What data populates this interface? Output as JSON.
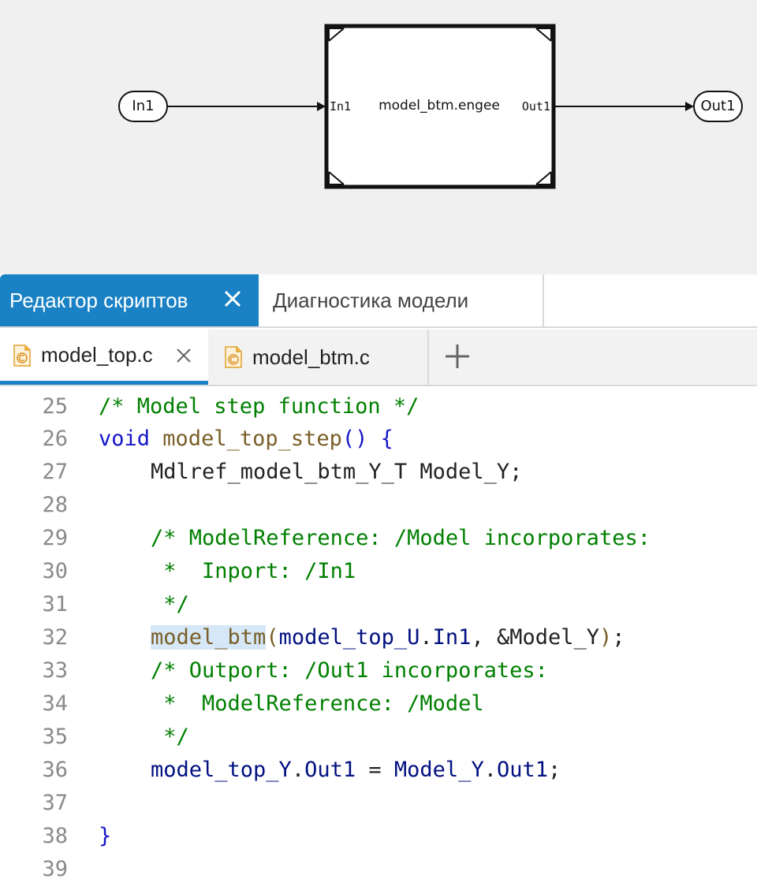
{
  "diagram": {
    "inport_label": "In1",
    "outport_label": "Out1",
    "block_title": "model_btm.engee",
    "block_in_port": "In1",
    "block_out_port": "Out1"
  },
  "panel_tabs": [
    {
      "label": "Редактор скриптов",
      "active": true
    },
    {
      "label": "Диагностика модели",
      "active": false
    }
  ],
  "file_tabs": [
    {
      "label": "model_top.c",
      "active": true
    },
    {
      "label": "model_btm.c",
      "active": false
    }
  ],
  "editor": {
    "partial_line": "/* Model step function */",
    "lines": [
      {
        "num": "26",
        "parts": [
          "void",
          " ",
          "model_top_step",
          "()",
          " ",
          "{"
        ]
      },
      {
        "num": "27",
        "text": "Mdlref_model_btm_Y_T Model_Y;"
      },
      {
        "num": "28",
        "text": ""
      },
      {
        "num": "29",
        "text": "/* ModelReference: /Model incorporates:"
      },
      {
        "num": "30",
        "text": " *  Inport: /In1"
      },
      {
        "num": "31",
        "text": " */"
      },
      {
        "num": "32",
        "parts": [
          "model_btm",
          "(",
          "model_top_U",
          ".",
          "In1",
          ",",
          " ",
          "&",
          "Model_Y",
          ")",
          ";"
        ]
      },
      {
        "num": "33",
        "text": "/* Outport: /Out1 incorporates:"
      },
      {
        "num": "34",
        "text": " *  ModelReference: /Model"
      },
      {
        "num": "35",
        "text": " */"
      },
      {
        "num": "36",
        "parts": [
          "model_top_Y",
          ".",
          "Out1",
          " ",
          "=",
          " ",
          "Model_Y",
          ".",
          "Out1",
          ";"
        ]
      },
      {
        "num": "37",
        "text": ""
      },
      {
        "num": "38",
        "text": "}"
      },
      {
        "num": "39",
        "text": ""
      }
    ]
  },
  "colors": {
    "accent": "#1a82c4",
    "keyword": "#1515c9",
    "function": "#795e26",
    "variable": "#001080",
    "comment": "#008000",
    "line_number": "#8a8a8a",
    "canvas_bg": "#f0f0f0"
  }
}
